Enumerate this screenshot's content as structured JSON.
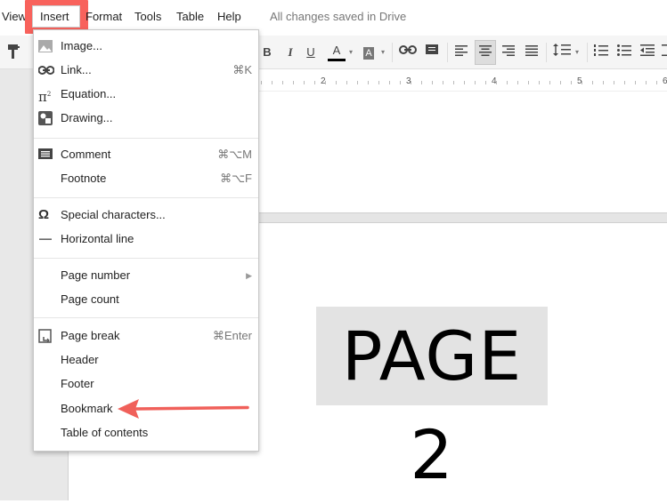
{
  "menubar": {
    "items": {
      "view": "View",
      "insert": "Insert",
      "format": "Format",
      "tools": "Tools",
      "table": "Table",
      "help": "Help"
    },
    "status": "All changes saved in Drive"
  },
  "toolbar": {
    "bold": "B",
    "italic": "I",
    "text_color": "A",
    "highlight": "A"
  },
  "ruler": {
    "numbers": [
      "2",
      "3",
      "4",
      "5",
      "6"
    ]
  },
  "document": {
    "page2_text": "PAGE 2"
  },
  "insert_menu": {
    "image": "Image...",
    "link": "Link...",
    "link_shortcut": "⌘K",
    "equation": "Equation...",
    "drawing": "Drawing...",
    "comment": "Comment",
    "comment_shortcut": "⌘⌥M",
    "footnote": "Footnote",
    "footnote_shortcut": "⌘⌥F",
    "special_characters": "Special characters...",
    "horizontal_line": "Horizontal line",
    "page_number": "Page number",
    "page_count": "Page count",
    "page_break": "Page break",
    "page_break_shortcut": "⌘Enter",
    "header": "Header",
    "footer": "Footer",
    "bookmark": "Bookmark",
    "table_of_contents": "Table of contents"
  },
  "colors": {
    "highlight_box": "#f8625c",
    "annotation_arrow": "#f0605a",
    "text_color_bar": "#000000"
  }
}
